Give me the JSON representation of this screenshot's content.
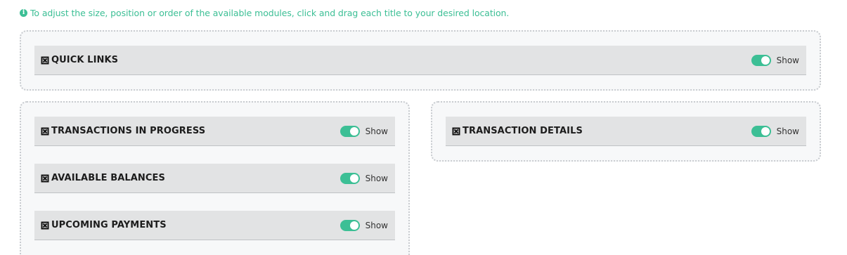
{
  "info": {
    "text": "To adjust the size, position or order of the available modules, click and drag each title to your desired location.",
    "icon": "info-circle-icon",
    "color": "#3cbf95"
  },
  "modules": {
    "quick_links": {
      "title": "QUICK LINKS",
      "toggle_label": "Show",
      "enabled": true
    },
    "transactions_in_progress": {
      "title": "TRANSACTIONS IN PROGRESS",
      "toggle_label": "Show",
      "enabled": true
    },
    "available_balances": {
      "title": "AVAILABLE BALANCES",
      "toggle_label": "Show",
      "enabled": true
    },
    "upcoming_payments": {
      "title": "UPCOMING PAYMENTS",
      "toggle_label": "Show",
      "enabled": true
    },
    "transaction_details": {
      "title": "TRANSACTION DETAILS",
      "toggle_label": "Show",
      "enabled": true
    }
  },
  "colors": {
    "accent": "#3cbf95",
    "module_bg": "#e2e3e4",
    "zone_bg": "#f7f8f9"
  },
  "icons": {
    "drag_handle": "move-arrows-icon",
    "toggle": "toggle-switch"
  }
}
